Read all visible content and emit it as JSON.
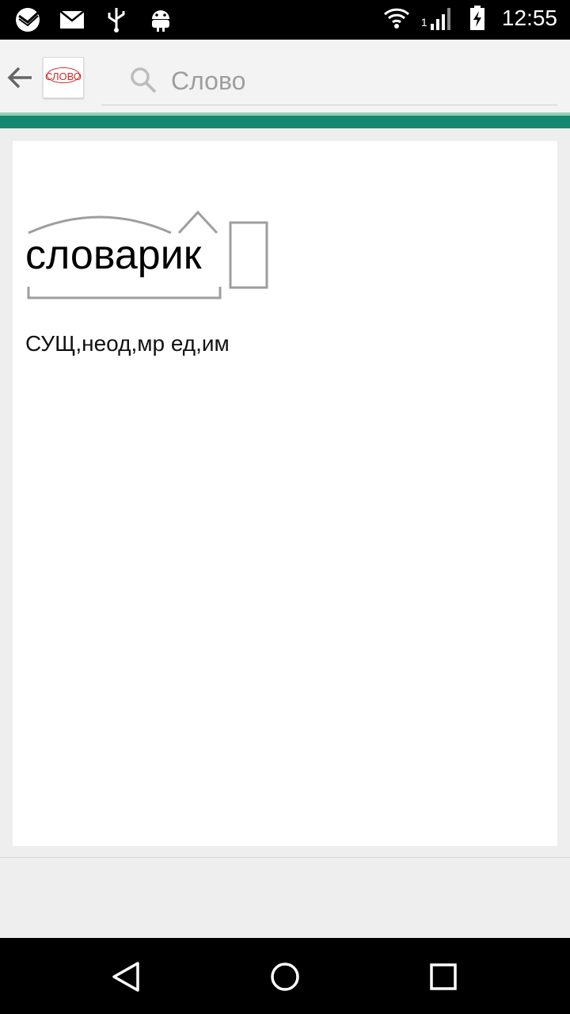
{
  "status_bar": {
    "time": "12:55",
    "sim_indicator": "1",
    "icons": [
      "sber-icon",
      "mail-icon",
      "usb-icon",
      "android-icon",
      "wifi-icon",
      "signal-icon",
      "battery-charging-icon"
    ]
  },
  "app_bar": {
    "logo_text": "СЛОВО",
    "search_placeholder": "Слово",
    "search_value": ""
  },
  "word_card": {
    "word": "словарик",
    "morphology": "СУЩ,неод,мр ед,им"
  },
  "colors": {
    "accent": "#16886f",
    "accent_light": "#8fd0b8",
    "logo_red": "#d42a2a"
  }
}
